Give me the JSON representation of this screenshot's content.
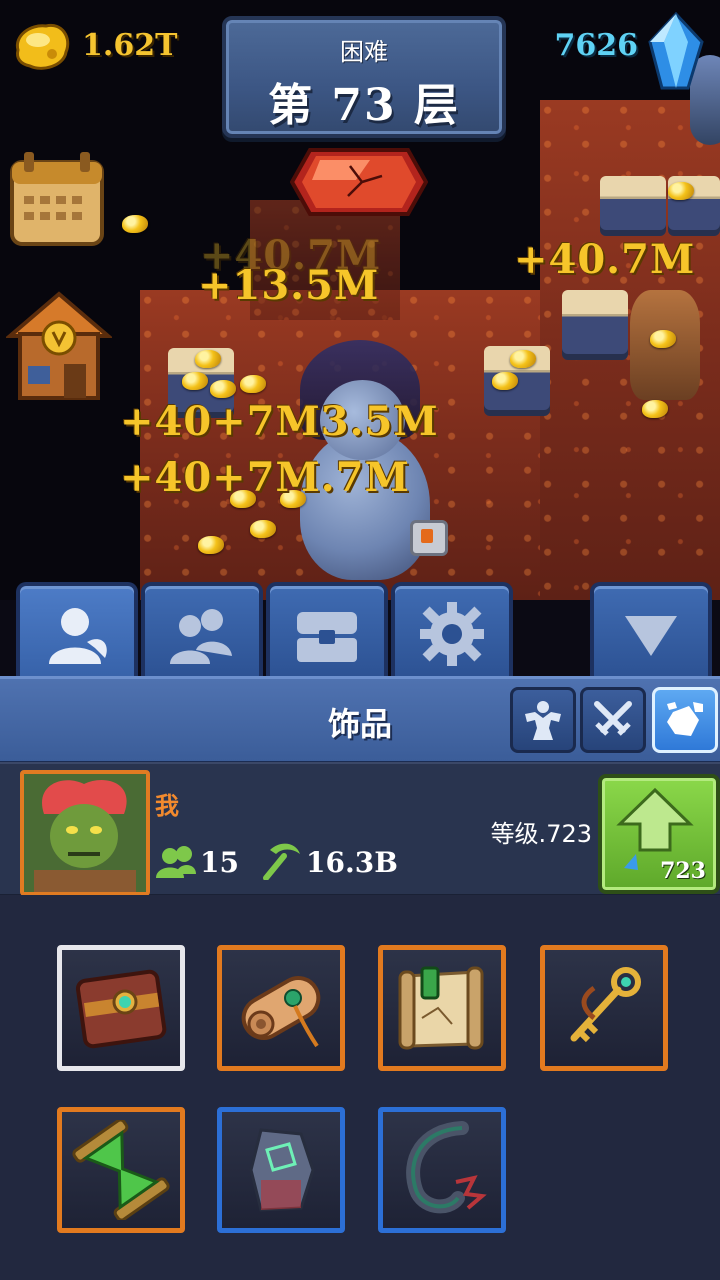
{
  "hud": {
    "gold": "1.62T",
    "gems": "7626",
    "difficulty": "困难",
    "floor": "第 73 层"
  },
  "floaters": [
    "+40.7M",
    "+13.5M",
    "+40.7M",
    "+40+7M3.5M",
    "+40+7M.7M"
  ],
  "tabs": [
    {
      "name": "hero-tab",
      "icon": "hero-icon"
    },
    {
      "name": "team-tab",
      "icon": "team-icon"
    },
    {
      "name": "chest-tab",
      "icon": "chest-icon"
    },
    {
      "name": "settings-tab",
      "icon": "gear-icon"
    },
    {
      "name": "collapse-tab",
      "icon": "triangle-down-icon"
    }
  ],
  "section": {
    "title": "饰品",
    "filters": [
      "strength-icon",
      "crossed-swords-icon",
      "gems-icon"
    ],
    "active_filter": 2
  },
  "profile": {
    "name": "我",
    "team_count": "15",
    "dps": "16.3B",
    "level_text": "等级.723",
    "upgrade_cost": "723"
  },
  "items": [
    {
      "name": "book",
      "rarity": "white"
    },
    {
      "name": "scroll-roll",
      "rarity": "orange"
    },
    {
      "name": "map-scroll",
      "rarity": "orange"
    },
    {
      "name": "golden-key",
      "rarity": "orange"
    },
    {
      "name": "hourglass",
      "rarity": "orange"
    },
    {
      "name": "rune-stone",
      "rarity": "blue"
    },
    {
      "name": "horn",
      "rarity": "blue"
    }
  ],
  "colors": {
    "gold": "#f5c430",
    "gem": "#5fd2f4",
    "legendary": "#e27a1f",
    "rare": "#2c6fd6",
    "common": "#e7e7ec",
    "upgrade": "#6fbf34"
  }
}
